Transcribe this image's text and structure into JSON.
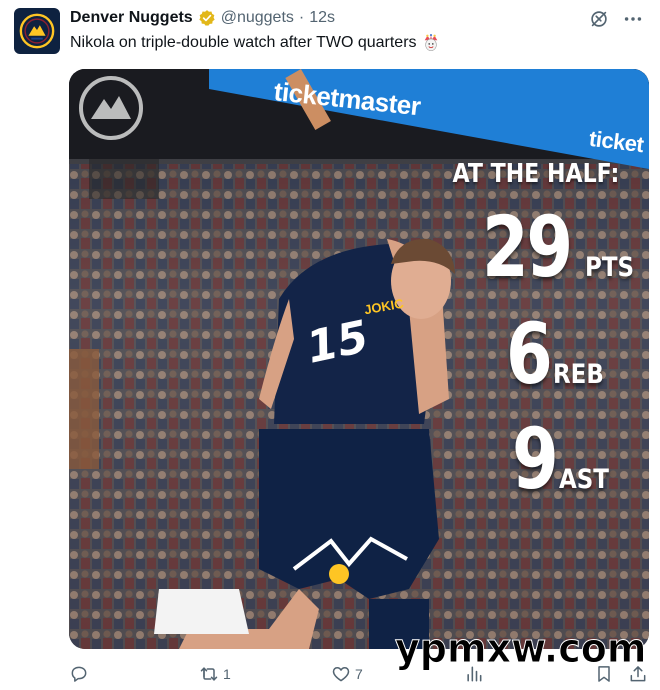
{
  "post": {
    "display_name": "Denver Nuggets",
    "handle": "@nuggets",
    "separator": "·",
    "time": "12s",
    "text": "Nikola on triple-double watch after TWO quarters",
    "emoji": "joker-emoji"
  },
  "media": {
    "banner_text": "ticketmaster",
    "banner_text_2": "ticket",
    "overlay_title": "AT THE HALF:",
    "stats": [
      {
        "value": "29",
        "unit": "PTS"
      },
      {
        "value": "6",
        "unit": "REB"
      },
      {
        "value": "9",
        "unit": "AST"
      }
    ],
    "jersey_name": "JOKIC",
    "jersey_number": "15"
  },
  "actions": {
    "reply_count": "",
    "retweet_count": "1",
    "like_count": "7",
    "views_count": ""
  },
  "watermark": "ypmxw.com",
  "colors": {
    "nuggets_navy": "#0e2240",
    "nuggets_gold": "#fec524",
    "ticketmaster_blue": "#1f7fd6",
    "verified_gold": "#e2b719",
    "secondary_text": "#536471"
  },
  "icons": [
    "reply-icon",
    "retweet-icon",
    "like-icon",
    "views-icon",
    "bookmark-icon",
    "share-icon",
    "grok-icon",
    "more-icon",
    "verified-badge-icon"
  ]
}
